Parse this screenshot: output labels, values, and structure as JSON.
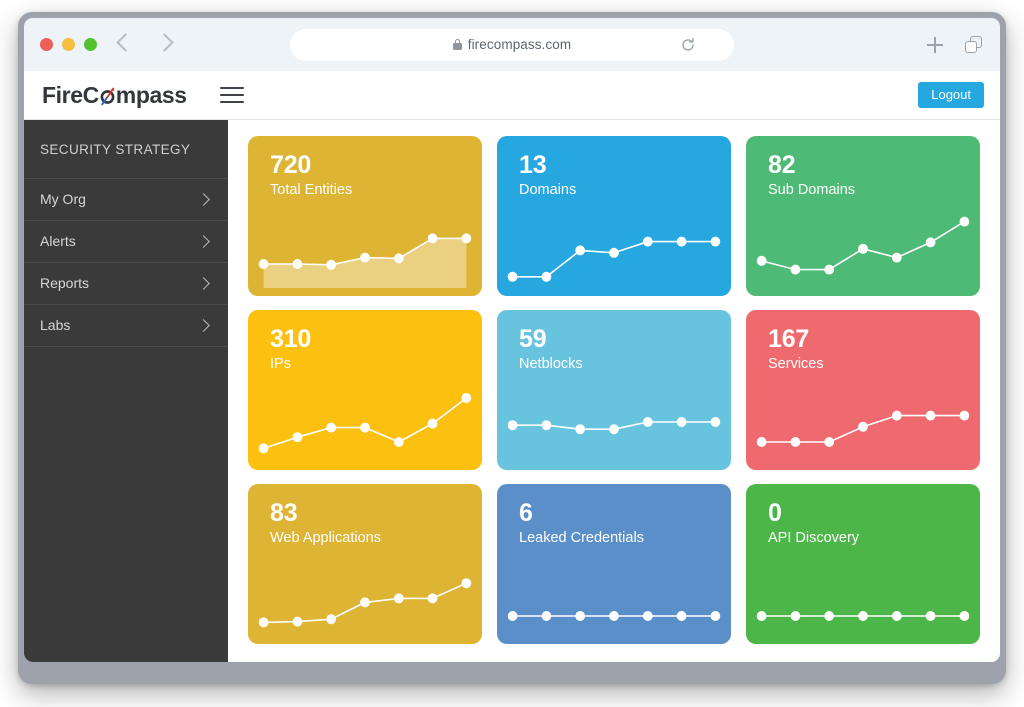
{
  "browser": {
    "url": "firecompass.com",
    "lock_icon": "lock-icon",
    "reload_icon": "reload-icon",
    "back_icon": "chevron-left-icon",
    "forward_icon": "chevron-right-icon",
    "new_tab_icon": "plus-icon",
    "tabs_icon": "tabs-icon",
    "traffic_lights": [
      "close-red",
      "minimize-yellow",
      "maximize-green"
    ]
  },
  "header": {
    "logo_part1": "FireC",
    "logo_part2": "mpass",
    "menu_icon": "hamburger-menu-icon",
    "logout_label": "Logout"
  },
  "sidebar": {
    "title": "SECURITY STRATEGY",
    "items": [
      {
        "label": "My Org",
        "icon": "chevron-right-icon"
      },
      {
        "label": "Alerts",
        "icon": "chevron-right-icon"
      },
      {
        "label": "Reports",
        "icon": "chevron-right-icon"
      },
      {
        "label": "Labs",
        "icon": "chevron-right-icon"
      }
    ]
  },
  "colors": {
    "gold": "#ddb433",
    "blue": "#27a7e0",
    "green": "#4dba76",
    "amber": "#fcc011",
    "light_blue": "#68c3de",
    "red": "#ef6a6e",
    "steel_blue": "#5b8fc9",
    "bright_green": "#4cb748",
    "sidebar": "#3a3a3a",
    "logout": "#27a7e0"
  },
  "cards": [
    {
      "value": "720",
      "label": "Total Entities",
      "color": "#ddb433",
      "fill": "rgba(255,255,255,0.38)",
      "chart_data": {
        "type": "area",
        "title": "Total Entities",
        "x": [
          0,
          1,
          2,
          3,
          4,
          5,
          6
        ],
        "values": [
          30,
          30,
          29,
          38,
          37,
          62,
          62
        ],
        "ylim": [
          0,
          100
        ],
        "grid": false,
        "legend": "none",
        "xlabel": "",
        "ylabel": ""
      }
    },
    {
      "value": "13",
      "label": "Domains",
      "color": "#27a7e0",
      "fill": "none",
      "chart_data": {
        "type": "line",
        "title": "Domains",
        "x": [
          0,
          1,
          2,
          3,
          4,
          5,
          6
        ],
        "values": [
          14,
          14,
          47,
          44,
          58,
          58,
          58
        ],
        "ylim": [
          0,
          100
        ],
        "grid": false,
        "legend": "none",
        "xlabel": "",
        "ylabel": ""
      }
    },
    {
      "value": "82",
      "label": "Sub Domains",
      "color": "#4dba76",
      "fill": "none",
      "chart_data": {
        "type": "line",
        "title": "Sub Domains",
        "x": [
          0,
          1,
          2,
          3,
          4,
          5,
          6
        ],
        "values": [
          34,
          23,
          23,
          49,
          38,
          57,
          83
        ],
        "ylim": [
          0,
          100
        ],
        "grid": false,
        "legend": "none",
        "xlabel": "",
        "ylabel": ""
      }
    },
    {
      "value": "310",
      "label": "IPs",
      "color": "#fcc011",
      "fill": "none",
      "chart_data": {
        "type": "line",
        "title": "IPs",
        "x": [
          0,
          1,
          2,
          3,
          4,
          5,
          6
        ],
        "values": [
          17,
          31,
          43,
          43,
          25,
          48,
          80
        ],
        "ylim": [
          0,
          100
        ],
        "grid": false,
        "legend": "none",
        "xlabel": "",
        "ylabel": ""
      }
    },
    {
      "value": "59",
      "label": "Netblocks",
      "color": "#68c3de",
      "fill": "none",
      "chart_data": {
        "type": "line",
        "title": "Netblocks",
        "x": [
          0,
          1,
          2,
          3,
          4,
          5,
          6
        ],
        "values": [
          46,
          46,
          41,
          41,
          50,
          50,
          50
        ],
        "ylim": [
          0,
          100
        ],
        "grid": false,
        "legend": "none",
        "xlabel": "",
        "ylabel": ""
      }
    },
    {
      "value": "167",
      "label": "Services",
      "color": "#ef6a6e",
      "fill": "none",
      "chart_data": {
        "type": "line",
        "title": "Services",
        "x": [
          0,
          1,
          2,
          3,
          4,
          5,
          6
        ],
        "values": [
          25,
          25,
          25,
          44,
          58,
          58,
          58
        ],
        "ylim": [
          0,
          100
        ],
        "grid": false,
        "legend": "none",
        "xlabel": "",
        "ylabel": ""
      }
    },
    {
      "value": "83",
      "label": "Web Applications",
      "color": "#ddb433",
      "fill": "none",
      "chart_data": {
        "type": "line",
        "title": "Web Applications",
        "x": [
          0,
          1,
          2,
          3,
          4,
          5,
          6
        ],
        "values": [
          17,
          18,
          21,
          42,
          47,
          47,
          66
        ],
        "ylim": [
          0,
          100
        ],
        "grid": false,
        "legend": "none",
        "xlabel": "",
        "ylabel": ""
      }
    },
    {
      "value": "6",
      "label": "Leaked Credentials",
      "color": "#5b8fc9",
      "fill": "none",
      "chart_data": {
        "type": "line",
        "title": "Leaked Credentials",
        "x": [
          0,
          1,
          2,
          3,
          4,
          5,
          6
        ],
        "values": [
          25,
          25,
          25,
          25,
          25,
          25,
          25
        ],
        "ylim": [
          0,
          100
        ],
        "grid": false,
        "legend": "none",
        "xlabel": "",
        "ylabel": ""
      }
    },
    {
      "value": "0",
      "label": "API Discovery",
      "color": "#4cb748",
      "fill": "none",
      "chart_data": {
        "type": "line",
        "title": "API Discovery",
        "x": [
          0,
          1,
          2,
          3,
          4,
          5,
          6
        ],
        "values": [
          25,
          25,
          25,
          25,
          25,
          25,
          25
        ],
        "ylim": [
          0,
          100
        ],
        "grid": false,
        "legend": "none",
        "xlabel": "",
        "ylabel": ""
      }
    }
  ]
}
